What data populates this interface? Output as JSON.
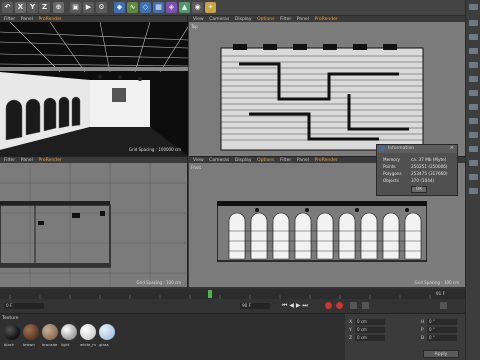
{
  "viewport_menus": {
    "perspective": [
      "Filter",
      "Panel",
      "ProRender"
    ],
    "top": [
      "View",
      "Cameras",
      "Display",
      "Options",
      "Filter",
      "Panel",
      "ProRender"
    ],
    "bottom_left": [
      "Filter",
      "Panel",
      "ProRender"
    ],
    "front": [
      "View",
      "Cameras",
      "Display",
      "Options",
      "Filter",
      "Panel",
      "ProRender"
    ]
  },
  "viewports": {
    "top_label": "Top",
    "front_label": "Front",
    "persp_grid": "Grid Spacing : 100000 cm",
    "left_grid": "Grid Spacing : 100 cm",
    "front_grid": "Grid Spacing : 100 cm"
  },
  "info_dialog": {
    "title": "Information",
    "rows": [
      {
        "label": "Memory",
        "value": "ca. 37 Mb (Myte)"
      },
      {
        "label": "Points",
        "value": "250251 (250006)"
      },
      {
        "label": "Polygons",
        "value": "253475 (317660)"
      },
      {
        "label": "Objects",
        "value": "370 (1044)"
      }
    ],
    "ok_label": "OK"
  },
  "timeline": {
    "current_frame": "0 F",
    "end_frame": "90 F",
    "frame_right": "91 F"
  },
  "materials": {
    "header": "Texture",
    "items": [
      {
        "label": "black",
        "color": "#111111"
      },
      {
        "label": "brown",
        "color": "#5a3a22"
      },
      {
        "label": "brocade",
        "color": "#8a6f55"
      },
      {
        "label": "light",
        "color": "#d0d0d0"
      },
      {
        "label": "white_m",
        "color": "#eeeeee"
      },
      {
        "label": "glass",
        "color": "#a9c7de"
      }
    ]
  },
  "attributes": {
    "labels": [
      "X",
      "Y",
      "Z"
    ],
    "values": [
      "0 cm",
      "0 cm",
      "0 cm"
    ],
    "rot_labels": [
      "H",
      "P",
      "B"
    ],
    "rot_values": [
      "0 °",
      "0 °",
      "0 °"
    ],
    "apply_label": "Apply"
  },
  "toolbar": {
    "axis_x": "X",
    "axis_y": "Y",
    "axis_z": "Z"
  },
  "colors": {
    "accent": "#e9a23b",
    "viewport_bg": "#7b7b7b",
    "selection": "#ff7a00"
  }
}
